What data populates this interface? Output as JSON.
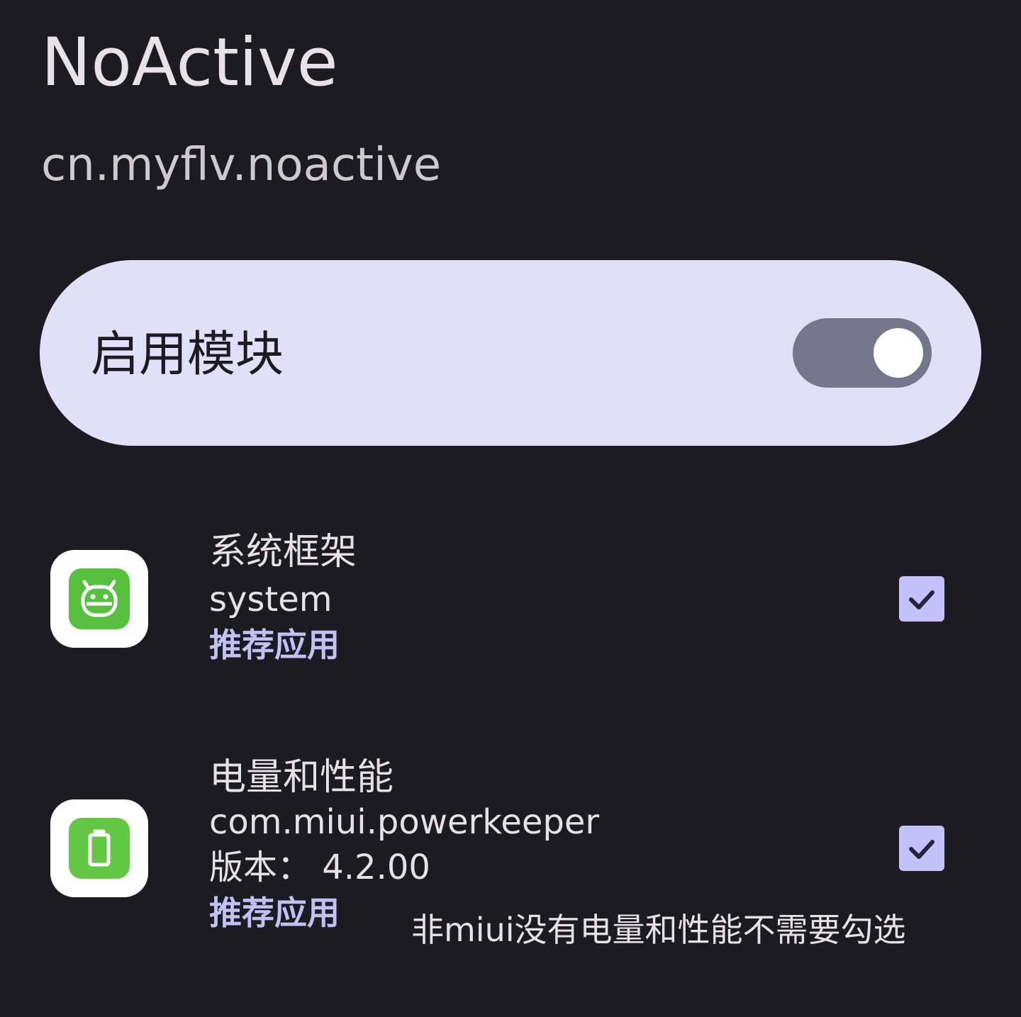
{
  "header": {
    "title": "NoActive",
    "package": "cn.myflv.noactive"
  },
  "module_switch": {
    "label": "启用模块",
    "enabled": false
  },
  "apps": [
    {
      "name": "系统框架",
      "package": "system",
      "recommend": "推荐应用",
      "checked": true,
      "icon": "android-icon"
    },
    {
      "name": "电量和性能",
      "package": "com.miui.powerkeeper",
      "version": "版本：  4.2.00",
      "recommend": "推荐应用",
      "note": "非miui没有电量和性能不需要勾选",
      "checked": true,
      "icon": "battery-icon"
    }
  ],
  "colors": {
    "background": "#1c1b22",
    "card": "#e2e0f9",
    "accent": "#c3c1f4",
    "icon_green": "#57c03f"
  }
}
